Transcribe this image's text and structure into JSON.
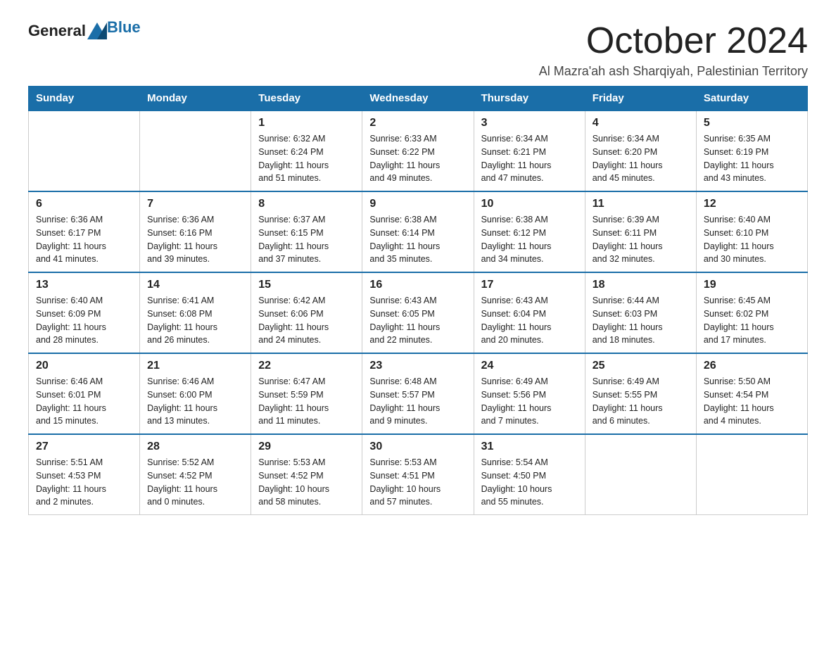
{
  "logo": {
    "text_general": "General",
    "text_blue": "Blue"
  },
  "title": "October 2024",
  "subtitle": "Al Mazra'ah ash Sharqiyah, Palestinian Territory",
  "days_of_week": [
    "Sunday",
    "Monday",
    "Tuesday",
    "Wednesday",
    "Thursday",
    "Friday",
    "Saturday"
  ],
  "weeks": [
    [
      {
        "day": "",
        "info": ""
      },
      {
        "day": "",
        "info": ""
      },
      {
        "day": "1",
        "info": "Sunrise: 6:32 AM\nSunset: 6:24 PM\nDaylight: 11 hours\nand 51 minutes."
      },
      {
        "day": "2",
        "info": "Sunrise: 6:33 AM\nSunset: 6:22 PM\nDaylight: 11 hours\nand 49 minutes."
      },
      {
        "day": "3",
        "info": "Sunrise: 6:34 AM\nSunset: 6:21 PM\nDaylight: 11 hours\nand 47 minutes."
      },
      {
        "day": "4",
        "info": "Sunrise: 6:34 AM\nSunset: 6:20 PM\nDaylight: 11 hours\nand 45 minutes."
      },
      {
        "day": "5",
        "info": "Sunrise: 6:35 AM\nSunset: 6:19 PM\nDaylight: 11 hours\nand 43 minutes."
      }
    ],
    [
      {
        "day": "6",
        "info": "Sunrise: 6:36 AM\nSunset: 6:17 PM\nDaylight: 11 hours\nand 41 minutes."
      },
      {
        "day": "7",
        "info": "Sunrise: 6:36 AM\nSunset: 6:16 PM\nDaylight: 11 hours\nand 39 minutes."
      },
      {
        "day": "8",
        "info": "Sunrise: 6:37 AM\nSunset: 6:15 PM\nDaylight: 11 hours\nand 37 minutes."
      },
      {
        "day": "9",
        "info": "Sunrise: 6:38 AM\nSunset: 6:14 PM\nDaylight: 11 hours\nand 35 minutes."
      },
      {
        "day": "10",
        "info": "Sunrise: 6:38 AM\nSunset: 6:12 PM\nDaylight: 11 hours\nand 34 minutes."
      },
      {
        "day": "11",
        "info": "Sunrise: 6:39 AM\nSunset: 6:11 PM\nDaylight: 11 hours\nand 32 minutes."
      },
      {
        "day": "12",
        "info": "Sunrise: 6:40 AM\nSunset: 6:10 PM\nDaylight: 11 hours\nand 30 minutes."
      }
    ],
    [
      {
        "day": "13",
        "info": "Sunrise: 6:40 AM\nSunset: 6:09 PM\nDaylight: 11 hours\nand 28 minutes."
      },
      {
        "day": "14",
        "info": "Sunrise: 6:41 AM\nSunset: 6:08 PM\nDaylight: 11 hours\nand 26 minutes."
      },
      {
        "day": "15",
        "info": "Sunrise: 6:42 AM\nSunset: 6:06 PM\nDaylight: 11 hours\nand 24 minutes."
      },
      {
        "day": "16",
        "info": "Sunrise: 6:43 AM\nSunset: 6:05 PM\nDaylight: 11 hours\nand 22 minutes."
      },
      {
        "day": "17",
        "info": "Sunrise: 6:43 AM\nSunset: 6:04 PM\nDaylight: 11 hours\nand 20 minutes."
      },
      {
        "day": "18",
        "info": "Sunrise: 6:44 AM\nSunset: 6:03 PM\nDaylight: 11 hours\nand 18 minutes."
      },
      {
        "day": "19",
        "info": "Sunrise: 6:45 AM\nSunset: 6:02 PM\nDaylight: 11 hours\nand 17 minutes."
      }
    ],
    [
      {
        "day": "20",
        "info": "Sunrise: 6:46 AM\nSunset: 6:01 PM\nDaylight: 11 hours\nand 15 minutes."
      },
      {
        "day": "21",
        "info": "Sunrise: 6:46 AM\nSunset: 6:00 PM\nDaylight: 11 hours\nand 13 minutes."
      },
      {
        "day": "22",
        "info": "Sunrise: 6:47 AM\nSunset: 5:59 PM\nDaylight: 11 hours\nand 11 minutes."
      },
      {
        "day": "23",
        "info": "Sunrise: 6:48 AM\nSunset: 5:57 PM\nDaylight: 11 hours\nand 9 minutes."
      },
      {
        "day": "24",
        "info": "Sunrise: 6:49 AM\nSunset: 5:56 PM\nDaylight: 11 hours\nand 7 minutes."
      },
      {
        "day": "25",
        "info": "Sunrise: 6:49 AM\nSunset: 5:55 PM\nDaylight: 11 hours\nand 6 minutes."
      },
      {
        "day": "26",
        "info": "Sunrise: 5:50 AM\nSunset: 4:54 PM\nDaylight: 11 hours\nand 4 minutes."
      }
    ],
    [
      {
        "day": "27",
        "info": "Sunrise: 5:51 AM\nSunset: 4:53 PM\nDaylight: 11 hours\nand 2 minutes."
      },
      {
        "day": "28",
        "info": "Sunrise: 5:52 AM\nSunset: 4:52 PM\nDaylight: 11 hours\nand 0 minutes."
      },
      {
        "day": "29",
        "info": "Sunrise: 5:53 AM\nSunset: 4:52 PM\nDaylight: 10 hours\nand 58 minutes."
      },
      {
        "day": "30",
        "info": "Sunrise: 5:53 AM\nSunset: 4:51 PM\nDaylight: 10 hours\nand 57 minutes."
      },
      {
        "day": "31",
        "info": "Sunrise: 5:54 AM\nSunset: 4:50 PM\nDaylight: 10 hours\nand 55 minutes."
      },
      {
        "day": "",
        "info": ""
      },
      {
        "day": "",
        "info": ""
      }
    ]
  ]
}
